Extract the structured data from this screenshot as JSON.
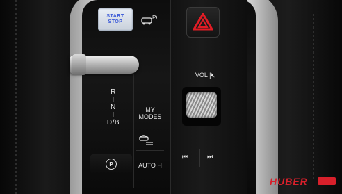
{
  "controls": {
    "start_stop": {
      "line1": "START",
      "line2": "STOP"
    },
    "park_assist_icon": "park-assist-icon",
    "hazard_icon": "hazard-icon",
    "gear_positions": [
      "R",
      "I",
      "N",
      "I",
      "D/B"
    ],
    "my_modes": {
      "line1": "MY",
      "line2": "MODES"
    },
    "hill_descent_icon": "hill-descent-icon",
    "park_brake": "P",
    "auto_hold": "AUTO H",
    "volume": "VOL",
    "prev_track_icon": "skip-back-icon",
    "next_track_icon": "skip-forward-icon"
  },
  "brand": {
    "logo_text": "HUBER"
  },
  "colors": {
    "hazard_red": "#e11c25",
    "start_stop_blue": "#3b5ad8",
    "logo_red": "#d8202b"
  }
}
